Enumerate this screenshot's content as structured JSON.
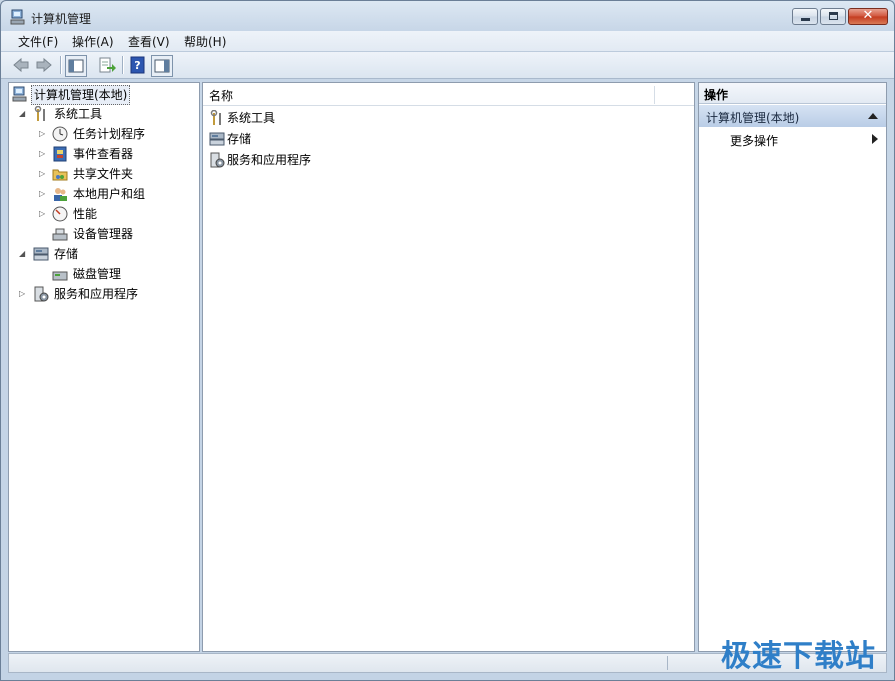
{
  "window": {
    "title": "计算机管理"
  },
  "menu": [
    {
      "label": "文件(F)"
    },
    {
      "label": "操作(A)"
    },
    {
      "label": "查看(V)"
    },
    {
      "label": "帮助(H)"
    }
  ],
  "toolbar": {
    "buttons": [
      {
        "name": "back-icon"
      },
      {
        "name": "forward-icon"
      },
      {
        "name": "show-hide-console-tree-icon"
      },
      {
        "name": "export-list-icon"
      },
      {
        "name": "help-icon"
      },
      {
        "name": "show-hide-action-pane-icon"
      }
    ]
  },
  "tree": {
    "root": "计算机管理(本地)",
    "system_tools": "系统工具",
    "task_scheduler": "任务计划程序",
    "event_viewer": "事件查看器",
    "shared_folders": "共享文件夹",
    "local_users": "本地用户和组",
    "performance": "性能",
    "device_manager": "设备管理器",
    "storage": "存储",
    "disk_management": "磁盘管理",
    "services_apps": "服务和应用程序"
  },
  "list": {
    "column_name": "名称",
    "items": [
      {
        "label": "系统工具"
      },
      {
        "label": "存储"
      },
      {
        "label": "服务和应用程序"
      }
    ]
  },
  "actions": {
    "header": "操作",
    "selected": "计算机管理(本地)",
    "more": "更多操作"
  },
  "watermark": "极速下载站",
  "colors": {
    "accent": "#2f7fc8",
    "selection": "#b9cde6"
  }
}
